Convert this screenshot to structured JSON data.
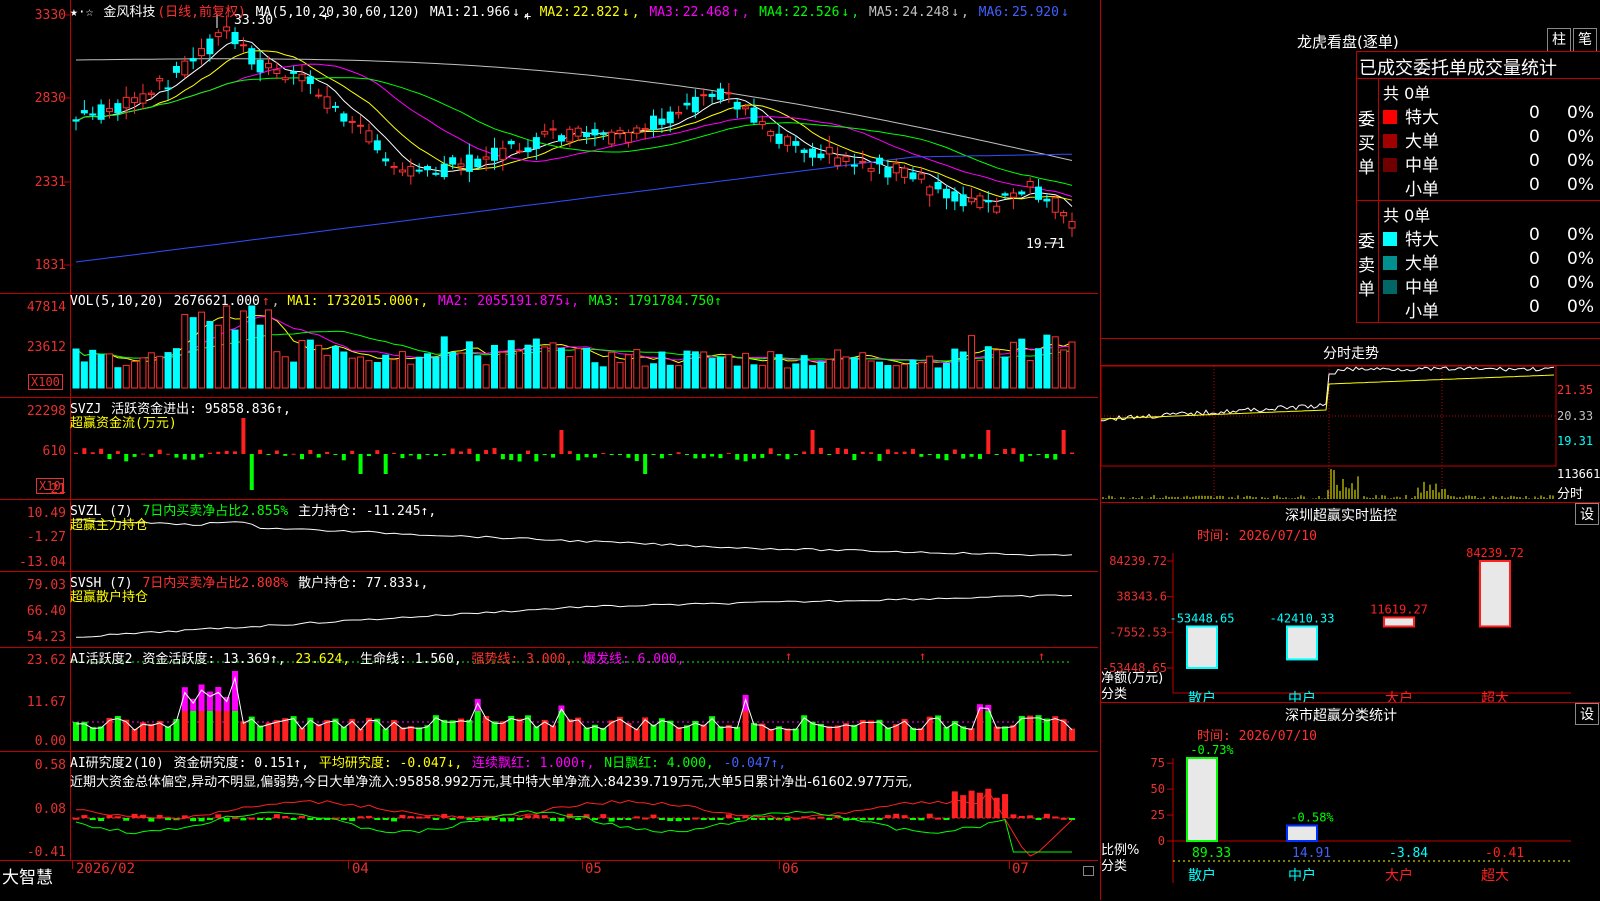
{
  "stock": {
    "star": "★·☆",
    "name": "金风科技",
    "period": "(日线,前复权)",
    "ma_title": "MA(5,10,20,30,60,120)",
    "ma": [
      {
        "label": "MA1:",
        "value": "21.966",
        "arrow": "↓"
      },
      {
        "label": "MA2:",
        "value": "22.822",
        "arrow": "↓"
      },
      {
        "label": "MA3:",
        "value": "22.468",
        "arrow": "↑"
      },
      {
        "label": "MA4:",
        "value": "22.526",
        "arrow": "↓"
      },
      {
        "label": "MA5:",
        "value": "24.248",
        "arrow": "↓"
      },
      {
        "label": "MA6:",
        "value": "25.920",
        "arrow": "↓"
      }
    ],
    "high_mark": "33.30",
    "low_mark": "19.71",
    "yticks": [
      "3330",
      "2830",
      "2331",
      "1831"
    ]
  },
  "vol": {
    "title": "VOL(5,10,20)",
    "value": "2676621.000",
    "arrow": "↑",
    "ma1": "MA1: 1732015.000↑,",
    "ma2": "MA2: 2055191.875↓,",
    "ma3": "MA3: 1791784.750↑",
    "yticks": [
      "47814",
      "23612"
    ],
    "unit": "X100"
  },
  "svzj": {
    "title": "SVZJ",
    "text": "活跃资金进出: 95858.836↑,",
    "sub": "超赢资金流(万元)",
    "yticks": [
      "22298",
      "610",
      "-21"
    ],
    "unit": "X10"
  },
  "svzl": {
    "title": "SVZL (7)",
    "text1": "7日内买卖净占比2.855%",
    "text2": "主力持仓: -11.245↑,",
    "sub": "超赢主力持仓",
    "yticks": [
      "10.49",
      "-1.27",
      "-13.04"
    ]
  },
  "svsh": {
    "title": "SVSH (7)",
    "text1": "7日内买卖净占比2.808%",
    "text2": "散户持仓: 77.833↓,",
    "sub": "超赢散户持仓",
    "yticks": [
      "79.03",
      "66.40",
      "54.23"
    ]
  },
  "ai1": {
    "title": "AI活跃度2",
    "t1": "资金活跃度: 13.369↑,",
    "t2": "23.624,",
    "t3": "生命线: 1.560,",
    "t4": "强势线: 3.000,",
    "t5": "爆发线: 6.000,",
    "yticks": [
      "23.62",
      "11.67",
      "0.00"
    ]
  },
  "ai2": {
    "title": "AI研究度2(10)",
    "t1": "资金研究度: 0.151↑,",
    "t2": "平均研究度: -0.047↓,",
    "t3": "连续飘红: 1.000↑,",
    "t4": "N日飘红: 4.000,",
    "t5": "-0.047↑,",
    "comment": "近期大资金总体偏空,异动不明显,偏弱势,今日大单净流入:95858.992万元,其中特大单净流入:84239.719万元,大单5日累计净出-61602.977万元,",
    "yticks": [
      "0.58",
      "0.08",
      "-0.41"
    ]
  },
  "xaxis": {
    "app": "大智慧",
    "labels": [
      "2026/02",
      "04",
      "05",
      "06",
      "07"
    ]
  },
  "longhu": {
    "title": "龙虎看盘(逐单)",
    "btn1": "柱",
    "btn2": "笔",
    "header": "已成交委托单成交量统计",
    "buy": {
      "side": "委买单",
      "total": "共 0单",
      "rows": [
        {
          "label": "特大",
          "color": "#ff0000",
          "n": "0",
          "pct": "0%"
        },
        {
          "label": "大单",
          "color": "#a00000",
          "n": "0",
          "pct": "0%"
        },
        {
          "label": "中单",
          "color": "#700000",
          "n": "0",
          "pct": "0%"
        },
        {
          "label": "小单",
          "color": "#000000",
          "n": "0",
          "pct": "0%"
        }
      ]
    },
    "sell": {
      "side": "委卖单",
      "total": "共 0单",
      "rows": [
        {
          "label": "特大",
          "color": "#00ffff",
          "n": "0",
          "pct": "0%"
        },
        {
          "label": "大单",
          "color": "#009090",
          "n": "0",
          "pct": "0%"
        },
        {
          "label": "中单",
          "color": "#006666",
          "n": "0",
          "pct": "0%"
        },
        {
          "label": "小单",
          "color": "#000000",
          "n": "0",
          "pct": "0%"
        }
      ]
    }
  },
  "fenshi": {
    "title": "分时走势",
    "y1": "21.35",
    "y2": "20.33",
    "y3": "19.31",
    "vol": "113661",
    "unit": "分时"
  },
  "monitor": {
    "title": "深圳超赢实时监控",
    "btn": "设",
    "date": "时间: 2026/07/10",
    "yticks": [
      "84239.72",
      "38343.6",
      "-7552.53",
      "-53448.65"
    ],
    "ylabel": "净额(万元)",
    "xlabel": "分类",
    "bars": [
      {
        "cat": "散户",
        "value": "-53448.65"
      },
      {
        "cat": "中户",
        "value": "-42410.33"
      },
      {
        "cat": "大户",
        "value": "11619.27"
      },
      {
        "cat": "超大",
        "value": "84239.72"
      }
    ]
  },
  "classify": {
    "title": "深市超赢分类统计",
    "btn": "设",
    "date": "时间: 2026/07/10",
    "yticks": [
      "75",
      "50",
      "25",
      "0"
    ],
    "ylabel": "比例%",
    "xlabel": "分类",
    "bars": [
      {
        "cat": "散户",
        "value": "89.33",
        "top": "-0.73%"
      },
      {
        "cat": "中户",
        "value": "14.91",
        "top": "-0.58%"
      },
      {
        "cat": "大户",
        "value": "-3.84",
        "top": ""
      },
      {
        "cat": "超大",
        "value": "-0.41",
        "top": ""
      }
    ]
  }
}
